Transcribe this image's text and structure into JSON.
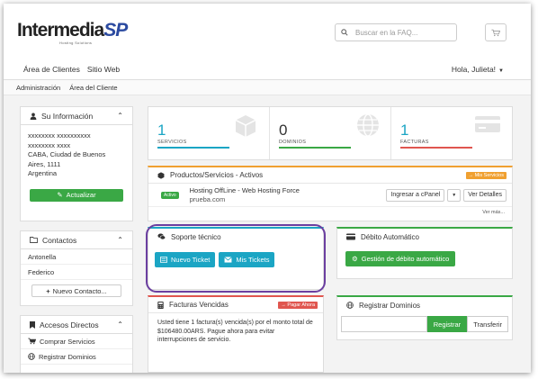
{
  "brand": {
    "name": "Intermedia",
    "suffix": "SP",
    "tagline": "Hosting Solutions"
  },
  "search": {
    "placeholder": "Buscar en la FAQ..."
  },
  "nav": {
    "items": [
      "Área de Clientes",
      "Sitio Web"
    ],
    "greeting": "Hola, Julieta!"
  },
  "breadcrumb": {
    "items": [
      "Administración",
      "Área del Cliente"
    ]
  },
  "sidebar": {
    "info": {
      "title": "Su Información",
      "lines": [
        "xxxxxxxx xxxxxxxxxx",
        "xxxxxxxx xxxx",
        "CABA, Ciudad de Buenos",
        "Aires, 1111",
        "Argentina"
      ],
      "update_label": "Actualizar"
    },
    "contacts": {
      "title": "Contactos",
      "items": [
        "Antonella",
        "Federico"
      ],
      "new_label": "Nuevo Contacto..."
    },
    "shortcuts": {
      "title": "Accesos Directos",
      "items": [
        "Comprar Servicios",
        "Registrar Dominios"
      ]
    }
  },
  "tiles": [
    {
      "value": "1",
      "label": "SERVICIOS",
      "color": "#1ba5c4"
    },
    {
      "value": "0",
      "label": "DOMINIOS",
      "color": "#3aa845"
    },
    {
      "value": "1",
      "label": "FACTURAS",
      "color": "#e0564f"
    }
  ],
  "products": {
    "title": "Productos/Servicios - Activos",
    "tag": "Mis Servicios",
    "status": "Activo",
    "name": "Hosting OffLine - Web Hosting Force",
    "domain": "prueba.com",
    "cpanel_label": "Ingresar a cPanel",
    "details_label": "Ver Detalles",
    "more_label": "Ver más..."
  },
  "support": {
    "title": "Soporte técnico",
    "new_ticket": "Nuevo Ticket",
    "my_tickets": "Mis Tickets"
  },
  "debit": {
    "title": "Débito Automático",
    "button": "Gestión de débito automático"
  },
  "invoices": {
    "title": "Facturas Vencidas",
    "tag": "Pagar Ahora",
    "message": "Usted tiene 1 factura(s) vencida(s) por el monto total de $106480.00ARS. Pague ahora para evitar interrupciones de servicio."
  },
  "domains": {
    "title": "Registrar Dominios",
    "register": "Registrar",
    "transfer": "Transferir"
  },
  "colors": {
    "accent_green": "#3aa845",
    "accent_teal": "#1ba5c4",
    "accent_orange": "#f0a030",
    "accent_red": "#e0564f",
    "highlight_purple": "#6b3fa0"
  }
}
